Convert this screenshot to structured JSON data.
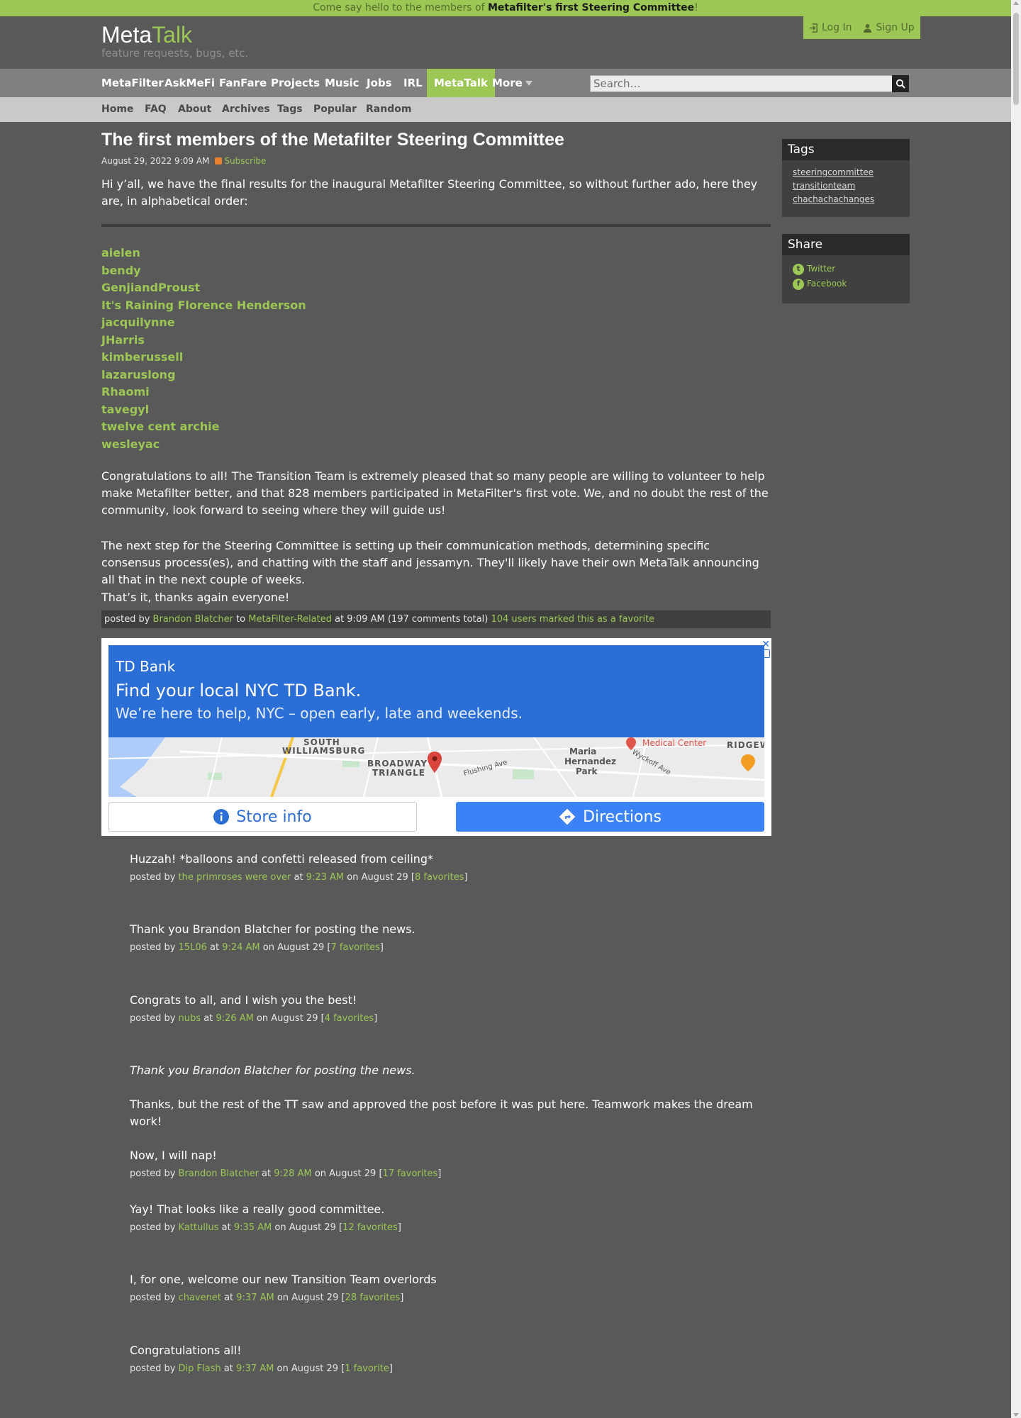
{
  "announcement": {
    "prefix": "Come say hello to the members of ",
    "link": "Metafilter's first Steering Committee",
    "suffix": "!"
  },
  "header": {
    "logo_meta": "Meta",
    "logo_talk": "Talk",
    "tagline": "feature requests, bugs, etc.",
    "login": "Log In",
    "signup": "Sign Up"
  },
  "mainnav": {
    "items": [
      "MetaFilter",
      "AskMeFi",
      "FanFare",
      "Projects",
      "Music",
      "Jobs",
      "IRL",
      "MetaTalk",
      "More"
    ],
    "search_placeholder": "Search…"
  },
  "subnav": {
    "items": [
      "Home",
      "FAQ",
      "About",
      "Archives",
      "Tags",
      "Popular",
      "Random"
    ]
  },
  "post": {
    "title": "The first members of the Metafilter Steering Committee",
    "date": "August 29, 2022 9:09 AM",
    "subscribe": "Subscribe",
    "intro": "Hi y’all, we have the final results for the inaugural Metafilter Steering Committee, so without further ado, here they are, in alphabetical order:",
    "members": [
      "aielen",
      "bendy",
      "GenjiandProust",
      "It's Raining Florence Henderson",
      "jacquilynne",
      "JHarris",
      "kimberussell",
      "lazaruslong",
      "Rhaomi",
      "tavegyl",
      "twelve cent archie",
      "wesleyac"
    ],
    "para1": "Congratulations to all! The Transition Team is extremely pleased that so many people are willing to volunteer to help make Metafilter better, and that 828 members participated in MetaFilter's first vote. We, and no doubt the rest of the community, look forward to seeing where they will guide us!",
    "para2": "The next step for the Steering Committee is setting up their communication methods, determining specific consensus process(es), and chatting with the staff and jessamyn. They'll likely have their own MetaTalk announcing all that in the next couple of weeks.",
    "para3": "That’s it, thanks again everyone!",
    "postedby": {
      "prefix": "posted by ",
      "author": "Brandon Blatcher",
      "to": " to ",
      "category": "MetaFilter-Related",
      "time_info": " at 9:09 AM (197 comments total) ",
      "favorites": "104 users marked this as a favorite"
    }
  },
  "ad": {
    "brand": "TD Bank",
    "title": "Find your local NYC TD Bank.",
    "subtitle": "We’re here to help, NYC – open early, late and weekends.",
    "map_labels": [
      "SOUTH",
      "WILLIAMSBURG",
      "BROADWAY",
      "TRIANGLE",
      "Medical Center",
      "Maria",
      "Hernandez",
      "Park",
      "RIDGEW",
      "Flushing Ave",
      "Wyckoff Ave"
    ],
    "store_info": "Store info",
    "directions": "Directions"
  },
  "comments": [
    {
      "text": "Huzzah! *balloons and confetti released from ceiling*",
      "author": "the primroses were over",
      "time": "9:23 AM",
      "date": "on August 29",
      "favs": "8 favorites"
    },
    {
      "text": "Thank you Brandon Blatcher for posting the news.",
      "author": "15L06",
      "time": "9:24 AM",
      "date": "on August 29",
      "favs": "7 favorites"
    },
    {
      "text": "Congrats to all, and I wish you the best!",
      "author": "nubs",
      "time": "9:26 AM",
      "date": "on August 29",
      "favs": "4 favorites"
    },
    {
      "quote": "Thank you Brandon Blatcher for posting the news.",
      "text": "Thanks, but the rest of the TT saw and approved the post before it was put here. Teamwork makes the dream work!",
      "text2": "Now, I will nap!",
      "author": "Brandon Blatcher",
      "time": "9:28 AM",
      "date": "on August 29",
      "favs": "17 favorites"
    },
    {
      "text": "Yay! That looks like a really good committee.",
      "author": "Kattullus",
      "time": "9:35 AM",
      "date": "on August 29",
      "favs": "12 favorites"
    },
    {
      "text": "I, for one, welcome our new Transition Team overlords",
      "author": "chavenet",
      "time": "9:37 AM",
      "date": "on August 29",
      "favs": "28 favorites"
    },
    {
      "text": "Congratulations all!",
      "author": "Dip Flash",
      "time": "9:37 AM",
      "date": "on August 29",
      "favs": "1 favorite"
    }
  ],
  "byline_words": {
    "posted_by": "posted by ",
    "at": " at ",
    "open": " [",
    "close": "]"
  },
  "sidebar": {
    "tags_title": "Tags",
    "tags": [
      "steeringcommittee",
      "transitionteam",
      "chachachachanges"
    ],
    "share_title": "Share",
    "share": [
      "Twitter",
      "Facebook"
    ]
  },
  "colors": {
    "accent": "#9cc754",
    "background": "#595959",
    "nav": "#808080",
    "subnav": "#c9c9c9"
  }
}
